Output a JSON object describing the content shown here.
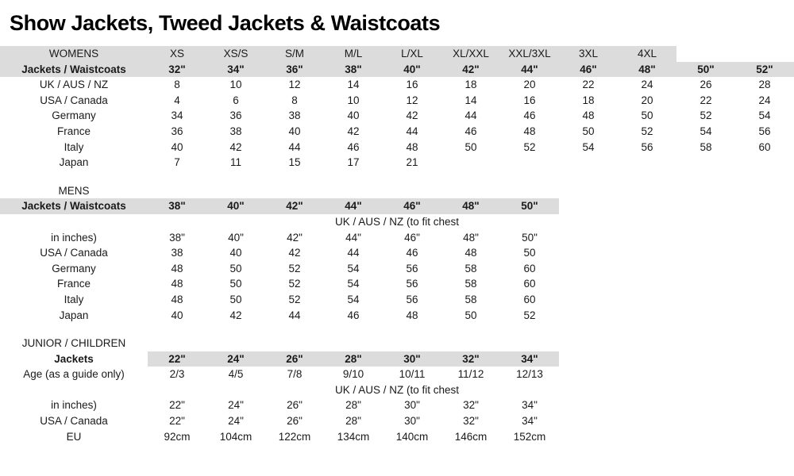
{
  "document": {
    "title": "Show Jackets, Tweed Jackets & Waistcoats",
    "accent_gray": "#dcdcdc",
    "text_color": "#1a1a1a"
  },
  "womens": {
    "section_label": "WOMENS",
    "row_label": "Jackets / Waistcoats",
    "size_names": [
      "XS",
      "XS/S",
      "S/M",
      "M/L",
      "L/XL",
      "XL/XXL",
      "XXL/3XL",
      "3XL",
      "4XL",
      "",
      ""
    ],
    "chest_sizes": [
      "32\"",
      "34\"",
      "36\"",
      "38\"",
      "40\"",
      "42\"",
      "44\"",
      "46\"",
      "48\"",
      "50\"",
      "52\""
    ],
    "rows": [
      {
        "label": "UK / AUS / NZ",
        "values": [
          "8",
          "10",
          "12",
          "14",
          "16",
          "18",
          "20",
          "22",
          "24",
          "26",
          "28"
        ]
      },
      {
        "label": "USA / Canada",
        "values": [
          "4",
          "6",
          "8",
          "10",
          "12",
          "14",
          "16",
          "18",
          "20",
          "22",
          "24"
        ]
      },
      {
        "label": "Germany",
        "values": [
          "34",
          "36",
          "38",
          "40",
          "42",
          "44",
          "46",
          "48",
          "50",
          "52",
          "54"
        ]
      },
      {
        "label": "France",
        "values": [
          "36",
          "38",
          "40",
          "42",
          "44",
          "46",
          "48",
          "50",
          "52",
          "54",
          "56"
        ]
      },
      {
        "label": "Italy",
        "values": [
          "40",
          "42",
          "44",
          "46",
          "48",
          "50",
          "52",
          "54",
          "56",
          "58",
          "60"
        ]
      },
      {
        "label": "Japan",
        "values": [
          "7",
          "11",
          "15",
          "17",
          "21",
          "",
          "",
          "",
          "",
          "",
          ""
        ]
      }
    ]
  },
  "mens": {
    "section_label": "MENS",
    "row_label": "Jackets / Waistcoats",
    "chest_sizes": [
      "38\"",
      "40\"",
      "42\"",
      "44\"",
      "46\"",
      "48\"",
      "50\""
    ],
    "uk_label_line1": "UK / AUS / NZ (to fit chest",
    "uk_label_line2": "in inches)",
    "uk_values": [
      "38\"",
      "40\"",
      "42\"",
      "44\"",
      "46\"",
      "48\"",
      "50\""
    ],
    "rows": [
      {
        "label": "USA / Canada",
        "values": [
          "38",
          "40",
          "42",
          "44",
          "46",
          "48",
          "50"
        ]
      },
      {
        "label": "Germany",
        "values": [
          "48",
          "50",
          "52",
          "54",
          "56",
          "58",
          "60"
        ]
      },
      {
        "label": "France",
        "values": [
          "48",
          "50",
          "52",
          "54",
          "56",
          "58",
          "60"
        ]
      },
      {
        "label": "Italy",
        "values": [
          "48",
          "50",
          "52",
          "54",
          "56",
          "58",
          "60"
        ]
      },
      {
        "label": "Japan",
        "values": [
          "40",
          "42",
          "44",
          "46",
          "48",
          "50",
          "52"
        ]
      }
    ]
  },
  "junior": {
    "section_label": "JUNIOR / CHILDREN",
    "row_label": "Jackets",
    "chest_sizes": [
      "22\"",
      "24\"",
      "26\"",
      "28\"",
      "30\"",
      "32\"",
      "34\""
    ],
    "age_label": "Age (as a guide only)",
    "age_values": [
      "2/3",
      "4/5",
      "7/8",
      "9/10",
      "10/11",
      "11/12",
      "12/13"
    ],
    "uk_label_line1": "UK / AUS / NZ (to fit chest",
    "uk_label_line2": "in inches)",
    "uk_values": [
      "22\"",
      "24\"",
      "26\"",
      "28\"",
      "30\"",
      "32\"",
      "34\""
    ],
    "rows": [
      {
        "label": "USA / Canada",
        "values": [
          "22\"",
          "24\"",
          "26\"",
          "28\"",
          "30\"",
          "32\"",
          "34\""
        ]
      },
      {
        "label": "EU",
        "values": [
          "92cm",
          "104cm",
          "122cm",
          "134cm",
          "140cm",
          "146cm",
          "152cm"
        ]
      }
    ]
  }
}
